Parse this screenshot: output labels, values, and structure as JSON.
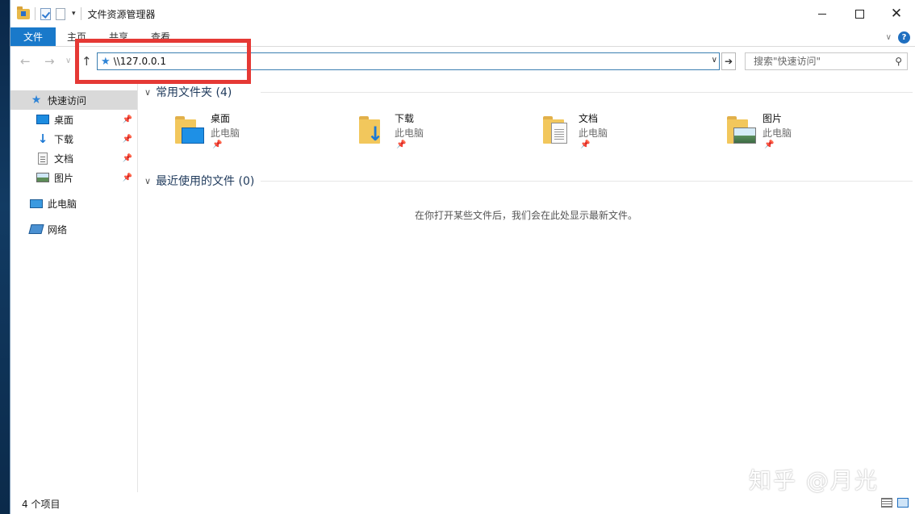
{
  "window": {
    "title": "文件资源管理器"
  },
  "ribbon": {
    "tabs": [
      "文件",
      "主页",
      "共享",
      "查看"
    ]
  },
  "nav": {
    "address_value": "\\\\127.0.0.1",
    "search_placeholder": "搜索\"快速访问\""
  },
  "sidebar": {
    "items": [
      {
        "label": "快速访问",
        "icon": "star-icon"
      },
      {
        "label": "桌面",
        "icon": "desktop-icon",
        "pinned": true
      },
      {
        "label": "下载",
        "icon": "download-icon",
        "pinned": true
      },
      {
        "label": "文档",
        "icon": "documents-icon",
        "pinned": true
      },
      {
        "label": "图片",
        "icon": "pictures-icon",
        "pinned": true
      },
      {
        "label": "此电脑",
        "icon": "this-pc-icon"
      },
      {
        "label": "网络",
        "icon": "network-icon"
      }
    ]
  },
  "content": {
    "frequent_header": "常用文件夹 (4)",
    "folders": [
      {
        "name": "桌面",
        "location": "此电脑",
        "icon": "desktop-folder-icon"
      },
      {
        "name": "下载",
        "location": "此电脑",
        "icon": "downloads-folder-icon"
      },
      {
        "name": "文档",
        "location": "此电脑",
        "icon": "documents-folder-icon"
      },
      {
        "name": "图片",
        "location": "此电脑",
        "icon": "pictures-folder-icon"
      }
    ],
    "recent_header": "最近使用的文件 (0)",
    "recent_empty_message": "在你打开某些文件后，我们会在此处显示最新文件。"
  },
  "status": {
    "item_count": "4 个项目"
  },
  "watermark": "知乎 @月光",
  "colors": {
    "accent": "#1979ca",
    "highlight_box": "#e53935"
  }
}
